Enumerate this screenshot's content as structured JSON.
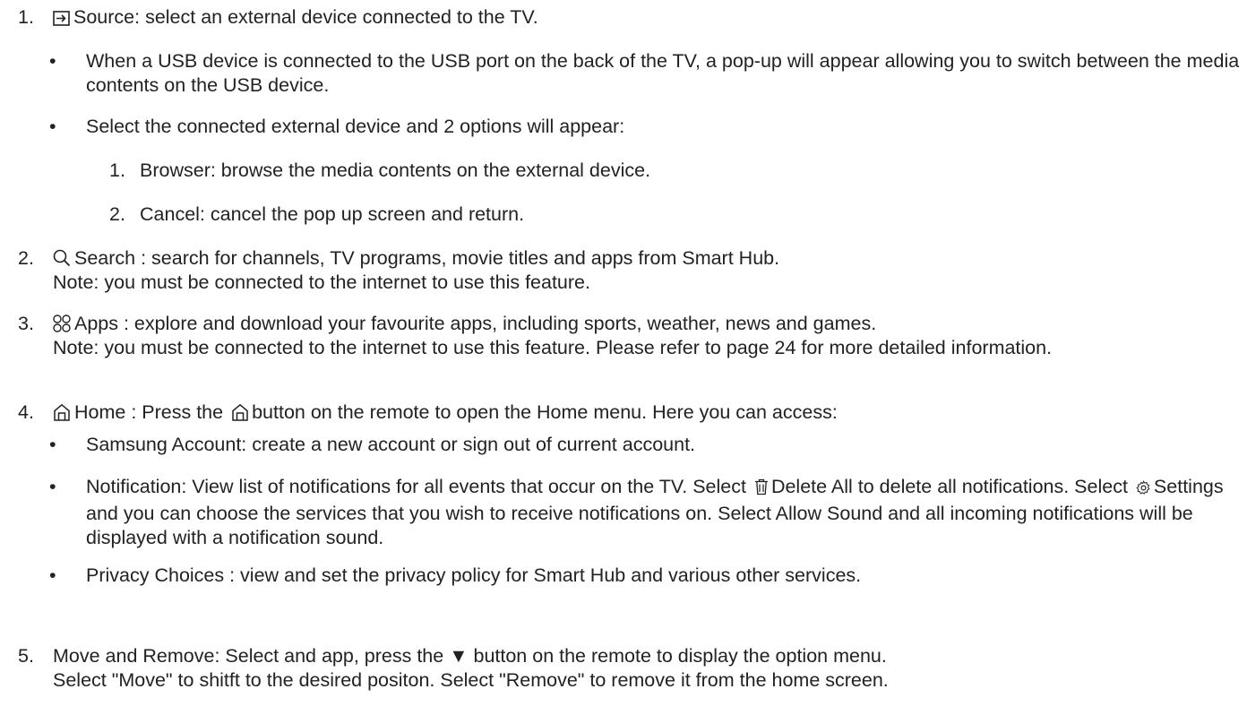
{
  "items": {
    "i1": {
      "num": "1.",
      "icon": "source-icon",
      "text": "Source: select an external device connected to the TV.",
      "bullets": [
        "When a USB device is connected to the USB port on the back of the TV, a pop-up will appear allowing you to switch between the media contents on the USB device.",
        "Select the connected external device and 2 options will appear:"
      ],
      "sub": [
        {
          "num": "1.",
          "text": "Browser: browse the media contents on the external device."
        },
        {
          "num": "2.",
          "text": "Cancel: cancel the pop up screen and return."
        }
      ]
    },
    "i2": {
      "num": "2.",
      "icon": "search-icon",
      "text": "Search : search for channels, TV programs, movie titles and apps from Smart Hub.",
      "note": "Note: you must be connected to the internet to use this feature."
    },
    "i3": {
      "num": "3.",
      "icon": "apps-icon",
      "text": "Apps : explore and download your favourite apps, including sports, weather, news and games.",
      "note": "Note: you must be connected to the internet to use this feature. Please refer to page 24 for more detailed information."
    },
    "i4": {
      "num": "4.",
      "icon": "home-icon",
      "text_a": "Home : Press the",
      "text_b": "button on the remote to open the Home menu. Here you can access:",
      "bullets": [
        "Samsung Account: create a new account or sign out of current account.",
        "Privacy Choices : view and set the privacy policy for Smart Hub and various other services."
      ],
      "notif_a": "Notification: View list of notifications for all events that occur on the TV. Select",
      "notif_b": "Delete All to delete all notifications. Select",
      "notif_c": "Settings and you can choose the services that you wish to receive notifications on. Select Allow Sound and all incoming notifications will be displayed with a notification sound."
    },
    "i5": {
      "num": "5.",
      "text_a": "Move and Remove: Select and app, press the",
      "text_b": "button on the remote to display the option menu.",
      "text_c": "Select \"Move\" to shitft to the desired positon. Select \"Remove\" to remove it from the home screen."
    }
  },
  "bullet_char": "•",
  "down_arrow": "▼"
}
